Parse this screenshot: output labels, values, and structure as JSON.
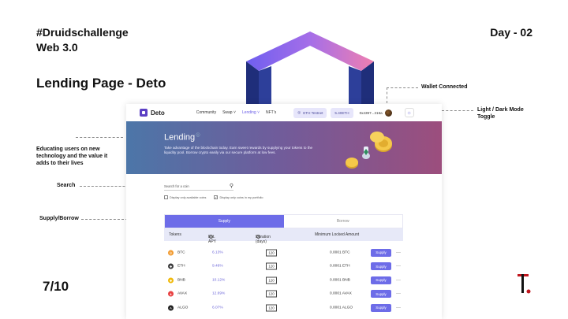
{
  "slide": {
    "hashtag": "#Druidschallenge",
    "subtitle": "Web 3.0",
    "title": "Lending Page - Deto",
    "day": "Day - 02",
    "page": "7/10"
  },
  "annotations": {
    "wallet": "Wallet Connected",
    "toggle": "Light / Dark Mode Toggle",
    "educating": "Educating users on new technology and the value it adds to their lives",
    "search": "Search",
    "supply_borrow": "Supply/Borrow"
  },
  "app": {
    "brand": "Deto",
    "nav": [
      "Community",
      "Swap ˅",
      "Lending ˅",
      "NFT's"
    ],
    "network": "ETH Testnet",
    "balance": "5.40ETH",
    "address": "0x4397...216a",
    "hero": {
      "title": "Lending",
      "body": "Take advantage of the blockchain today. Earn sweet rewards by supplying your tokens to the liquidity pool. Borrow crypto easily via our secure platform at low fees."
    },
    "search_placeholder": "Search for a coin",
    "filters": [
      {
        "label": "Display only available coins",
        "checked": false
      },
      {
        "label": "Display only coins in my portfolio",
        "checked": true
      }
    ],
    "tabs": [
      "Supply",
      "Borrow"
    ],
    "columns": [
      "Tokens",
      "Est. APY",
      "Duration (days)",
      "Minimum Locked Amount"
    ],
    "rows": [
      {
        "token": "BTC",
        "apy": "6.13%",
        "duration": "120",
        "min": "0.0001 BTC",
        "action": "Supply",
        "color": "#f29a2e",
        "glyph": "₿"
      },
      {
        "token": "ETH",
        "apy": "9.46%",
        "duration": "120",
        "min": "0.0001 ETH",
        "action": "Supply",
        "color": "#3c3c3d",
        "glyph": "◆"
      },
      {
        "token": "BNB",
        "apy": "10.12%",
        "duration": "120",
        "min": "0.0001 BNB",
        "action": "Supply",
        "color": "#f0b90b",
        "glyph": "◆"
      },
      {
        "token": "AVAX",
        "apy": "12.69%",
        "duration": "120",
        "min": "0.0001 AVAX",
        "action": "Supply",
        "color": "#e84142",
        "glyph": "▲"
      },
      {
        "token": "ALGO",
        "apy": "6.07%",
        "duration": "120",
        "min": "0.0001 ALGO",
        "action": "Supply",
        "color": "#222222",
        "glyph": "A"
      }
    ]
  },
  "colors": {
    "accent": "#6d6ce8",
    "hero_start": "#4c76a8",
    "hero_end": "#9c4e7d"
  }
}
